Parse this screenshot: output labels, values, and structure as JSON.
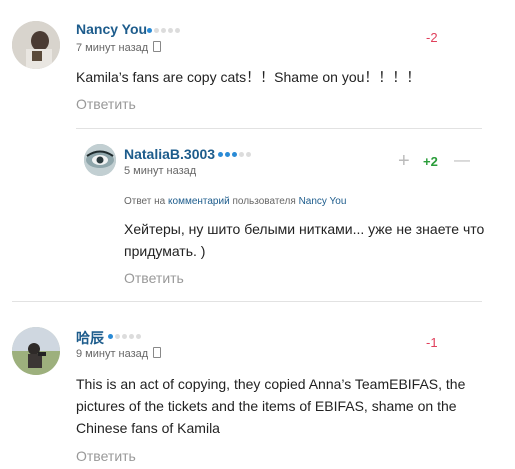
{
  "comments": [
    {
      "author": "Nancy You",
      "time": "7 минут назад",
      "score": "-2",
      "text": "Kamila’s fans are copy cats！！Shame on you！！！！",
      "reply_label": "Ответить"
    },
    {
      "author": "NataliaB.3003",
      "time": "5 минут назад",
      "reply_meta": {
        "prefix": "Ответ на",
        "link": "комментарий",
        "middle": "пользователя",
        "user": "Nancy You"
      },
      "score": "+2",
      "plus_icon": "+",
      "minus_icon": "—",
      "text": "Хейтеры, ну шито белыми нитками... уже не знаете что придумать. )",
      "reply_label": "Ответить"
    },
    {
      "author": "哈辰",
      "time": "9 минут назад",
      "score": "-1",
      "text": "This is an act of copying, they copied Anna’s TeamEBIFAS, the pictures of the tickets and the items of EBIFAS, shame on the Chinese fans of Kamila",
      "reply_label": "Ответить"
    }
  ],
  "colors": {
    "author": "#1d5c8c",
    "negative": "#e0405c",
    "positive": "#2a9d3a",
    "muted": "#999999"
  }
}
